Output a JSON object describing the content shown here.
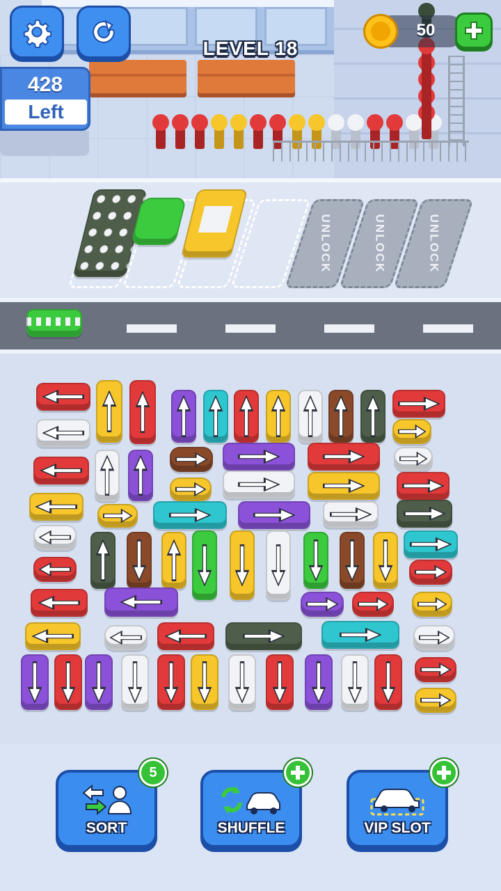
{
  "header": {
    "level_title": "LEVEL 18",
    "coins": "50",
    "settings_icon": "gear-icon",
    "restart_icon": "restart-icon",
    "add_coins_icon": "plus-icon"
  },
  "passengers_counter": {
    "count": "428",
    "label": "Left"
  },
  "passenger_queue": [
    "red",
    "red",
    "red",
    "yellow",
    "yellow",
    "red",
    "red",
    "yellow",
    "yellow",
    "white",
    "white",
    "red",
    "red",
    "white",
    "white"
  ],
  "passenger_stack_color": "red",
  "parking_slots": [
    {
      "state": "occupied",
      "vehicle": "bus",
      "color": "dark-green"
    },
    {
      "state": "occupied",
      "vehicle": "car",
      "color": "green"
    },
    {
      "state": "occupied",
      "vehicle": "van",
      "color": "yellow"
    },
    {
      "state": "empty"
    },
    {
      "state": "locked",
      "label": "UNLOCK"
    },
    {
      "state": "locked",
      "label": "UNLOCK"
    },
    {
      "state": "locked",
      "label": "UNLOCK"
    }
  ],
  "road_vehicle": {
    "vehicle": "van",
    "color": "green"
  },
  "colors": {
    "red": "#e23a3a",
    "white": "#f1f3f7",
    "yellow": "#f6c62a",
    "purple": "#8b52d9",
    "cyan": "#2ec6cf",
    "brown": "#8a4a2a",
    "dark-green": "#4f5e4a",
    "green": "#3ccb3f",
    "accent_blue": "#3b8ef0"
  },
  "board_vehicles": [
    {
      "color": "red",
      "dir": "left"
    },
    {
      "color": "yellow",
      "dir": "up"
    },
    {
      "color": "red",
      "dir": "up"
    },
    {
      "color": "purple",
      "dir": "up"
    },
    {
      "color": "cyan",
      "dir": "up"
    },
    {
      "color": "red",
      "dir": "up"
    },
    {
      "color": "yellow",
      "dir": "up"
    },
    {
      "color": "white",
      "dir": "up"
    },
    {
      "color": "brown",
      "dir": "up"
    },
    {
      "color": "dark-green",
      "dir": "up"
    },
    {
      "color": "red",
      "dir": "right"
    },
    {
      "color": "white",
      "dir": "left"
    },
    {
      "color": "yellow",
      "dir": "right"
    },
    {
      "color": "red",
      "dir": "left"
    },
    {
      "color": "white",
      "dir": "up"
    },
    {
      "color": "purple",
      "dir": "up"
    },
    {
      "color": "brown",
      "dir": "right"
    },
    {
      "color": "purple",
      "dir": "right"
    },
    {
      "color": "red",
      "dir": "right"
    },
    {
      "color": "white",
      "dir": "right"
    },
    {
      "color": "yellow",
      "dir": "right"
    },
    {
      "color": "white",
      "dir": "right"
    },
    {
      "color": "yellow",
      "dir": "right"
    },
    {
      "color": "red",
      "dir": "right"
    },
    {
      "color": "yellow",
      "dir": "left"
    },
    {
      "color": "yellow",
      "dir": "right"
    },
    {
      "color": "cyan",
      "dir": "right"
    },
    {
      "color": "purple",
      "dir": "right"
    },
    {
      "color": "white",
      "dir": "right"
    },
    {
      "color": "dark-green",
      "dir": "right"
    },
    {
      "color": "white",
      "dir": "left"
    },
    {
      "color": "cyan",
      "dir": "right"
    },
    {
      "color": "dark-green",
      "dir": "up"
    },
    {
      "color": "brown",
      "dir": "down"
    },
    {
      "color": "yellow",
      "dir": "up"
    },
    {
      "color": "green",
      "dir": "down"
    },
    {
      "color": "yellow",
      "dir": "down"
    },
    {
      "color": "white",
      "dir": "down"
    },
    {
      "color": "green",
      "dir": "down"
    },
    {
      "color": "brown",
      "dir": "down"
    },
    {
      "color": "yellow",
      "dir": "down"
    },
    {
      "color": "red",
      "dir": "left"
    },
    {
      "color": "red",
      "dir": "right"
    },
    {
      "color": "red",
      "dir": "left"
    },
    {
      "color": "purple",
      "dir": "left"
    },
    {
      "color": "purple",
      "dir": "right"
    },
    {
      "color": "red",
      "dir": "right"
    },
    {
      "color": "yellow",
      "dir": "right"
    },
    {
      "color": "yellow",
      "dir": "left"
    },
    {
      "color": "white",
      "dir": "left"
    },
    {
      "color": "red",
      "dir": "left"
    },
    {
      "color": "dark-green",
      "dir": "right"
    },
    {
      "color": "cyan",
      "dir": "right"
    },
    {
      "color": "white",
      "dir": "right"
    },
    {
      "color": "purple",
      "dir": "down"
    },
    {
      "color": "red",
      "dir": "down"
    },
    {
      "color": "purple",
      "dir": "down"
    },
    {
      "color": "white",
      "dir": "down"
    },
    {
      "color": "red",
      "dir": "down"
    },
    {
      "color": "yellow",
      "dir": "down"
    },
    {
      "color": "white",
      "dir": "down"
    },
    {
      "color": "red",
      "dir": "down"
    },
    {
      "color": "purple",
      "dir": "down"
    },
    {
      "color": "white",
      "dir": "down"
    },
    {
      "color": "red",
      "dir": "down"
    },
    {
      "color": "red",
      "dir": "right"
    },
    {
      "color": "yellow",
      "dir": "right"
    }
  ],
  "actions": {
    "sort": {
      "label": "SORT",
      "badge": "5",
      "icon": "sort-swap-icon"
    },
    "shuffle": {
      "label": "SHUFFLE",
      "badge_icon": "plus-icon",
      "icon": "shuffle-car-icon"
    },
    "vip_slot": {
      "label": "VIP SLOT",
      "badge_icon": "plus-icon",
      "icon": "vip-car-icon"
    }
  }
}
